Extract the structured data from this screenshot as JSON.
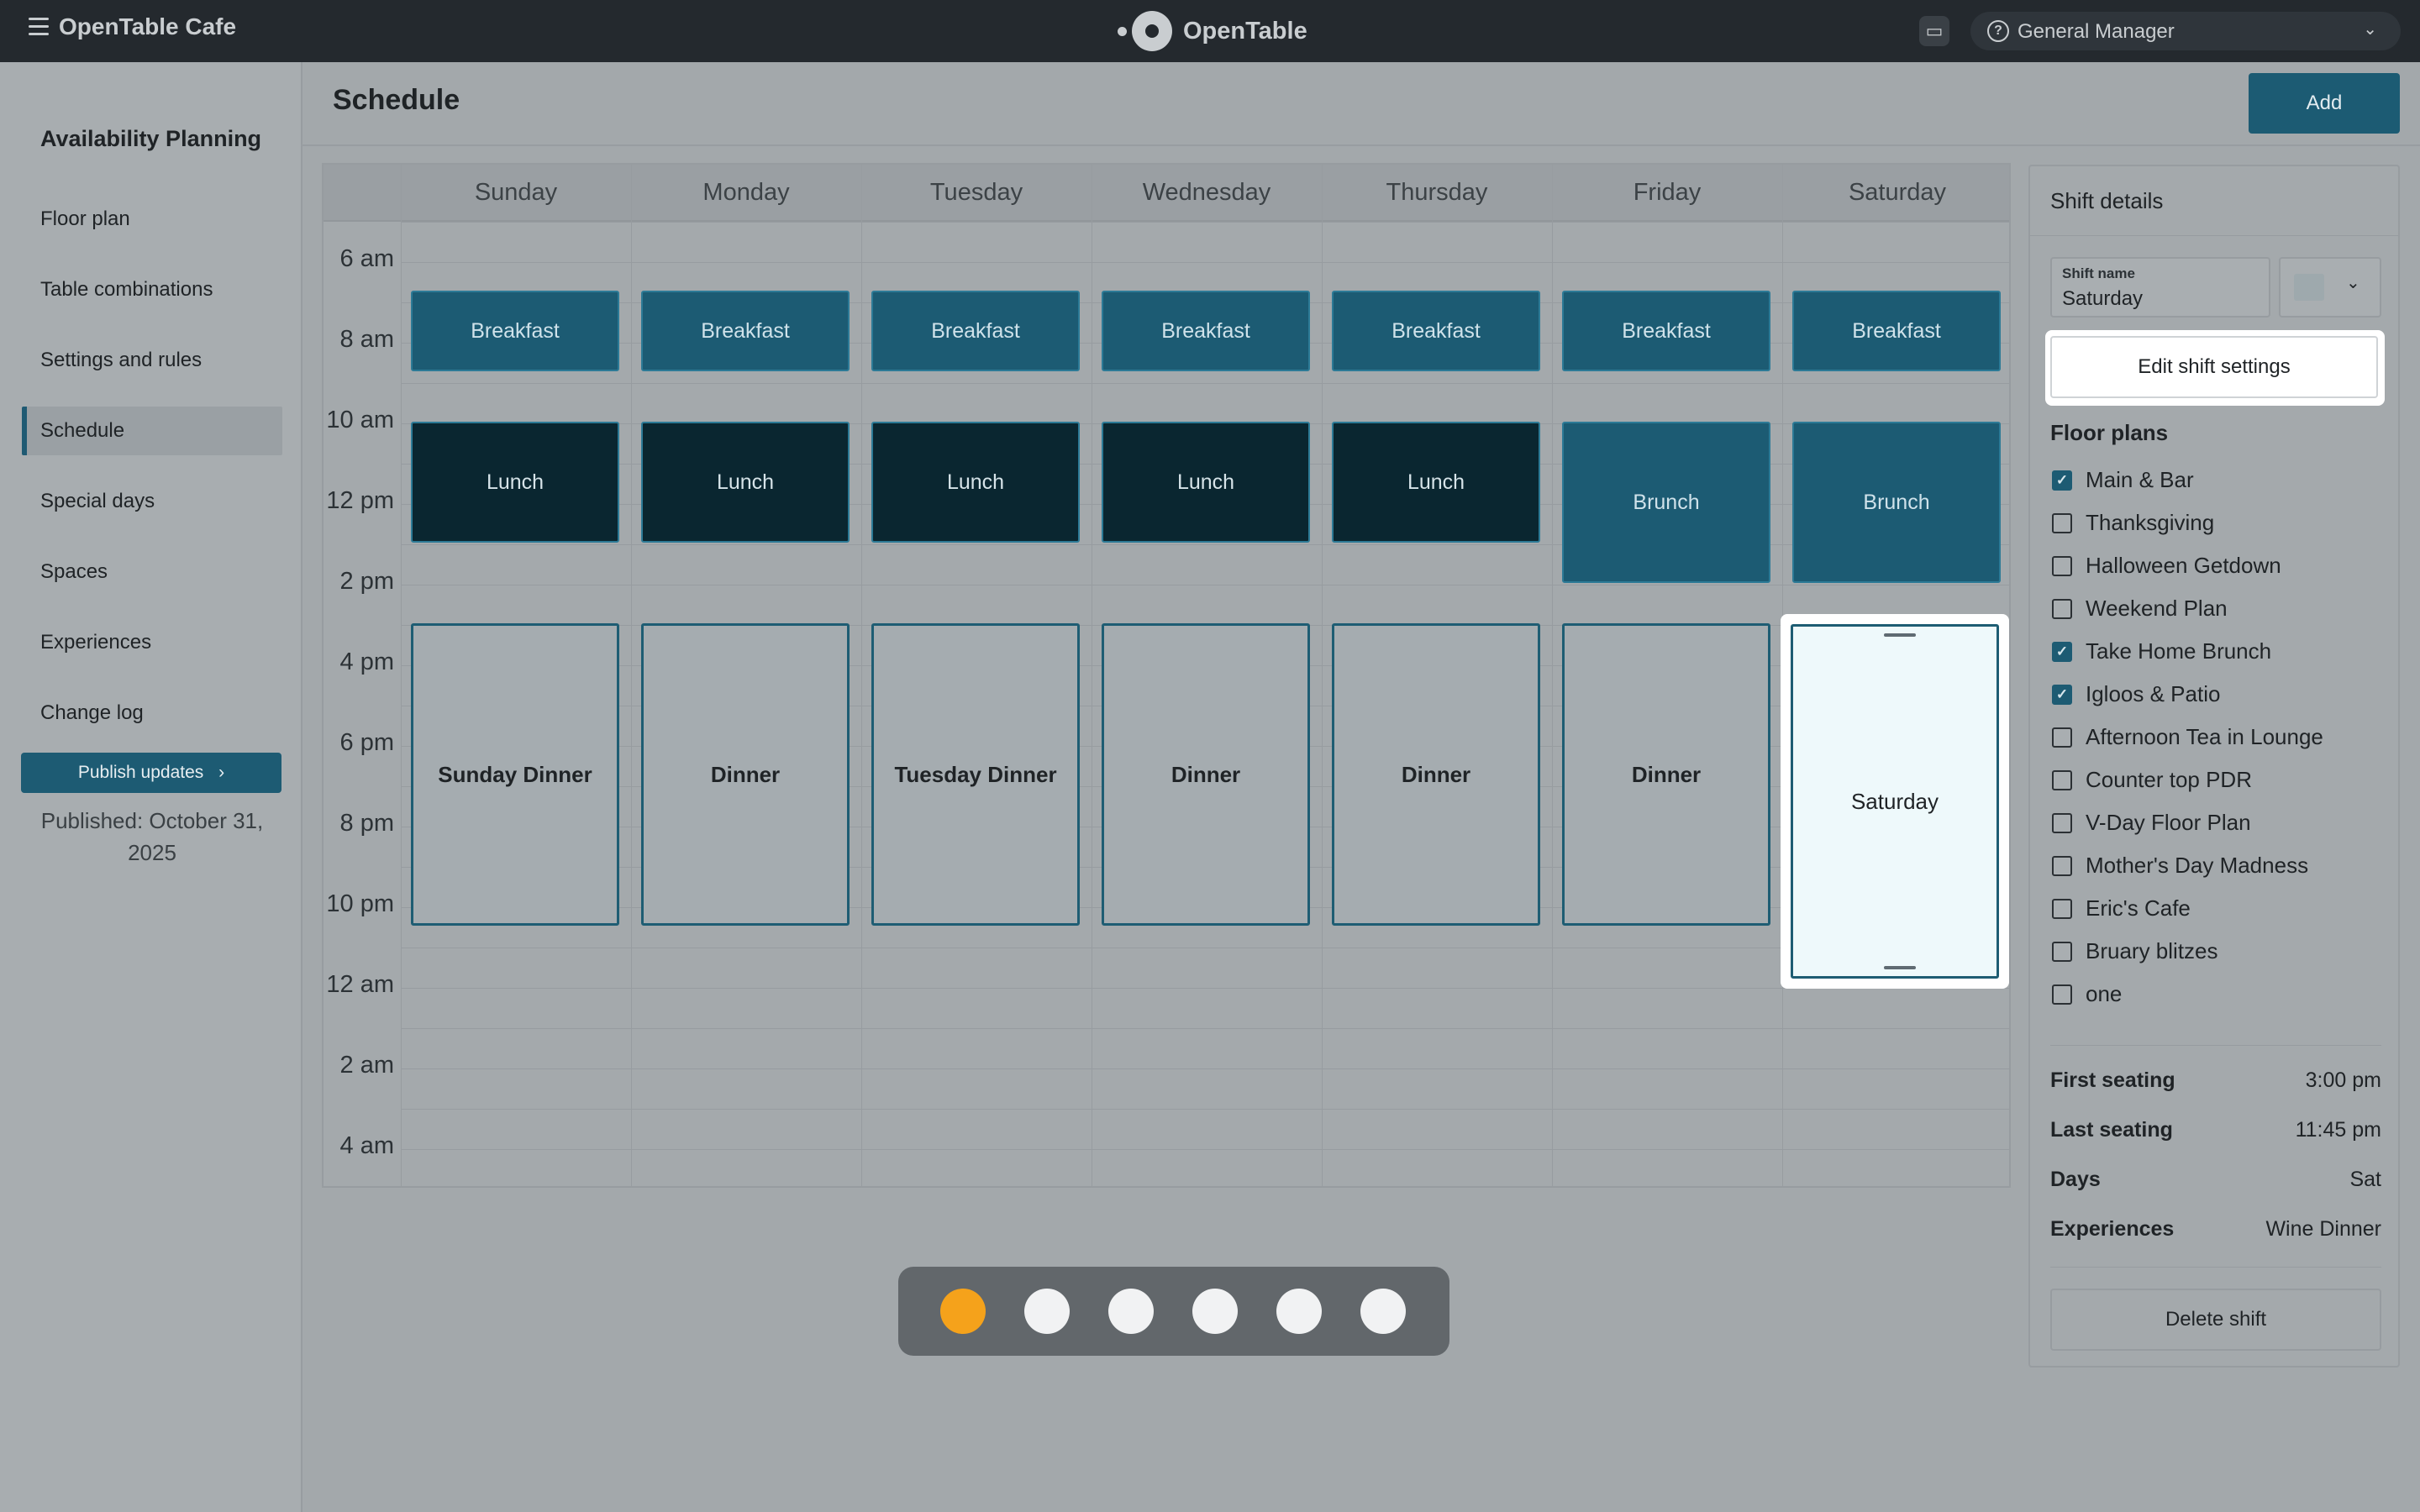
{
  "app": {
    "title": "OpenTable Cafe",
    "logo_text": "OpenTable",
    "role": "General Manager"
  },
  "icons": {
    "menu": "hamburger-icon",
    "chat": "chat-icon",
    "help": "help-circle-icon",
    "chevron": "chevron-down-icon"
  },
  "sidebar": {
    "heading": "Availability Planning",
    "items": [
      {
        "label": "Floor plan"
      },
      {
        "label": "Table combinations"
      },
      {
        "label": "Settings and rules"
      },
      {
        "label": "Schedule",
        "active": true
      },
      {
        "label": "Special days"
      },
      {
        "label": "Spaces"
      },
      {
        "label": "Experiences"
      },
      {
        "label": "Change log"
      }
    ],
    "publish_label": "Publish updates",
    "published_text": "Published: October 31, 2025"
  },
  "page": {
    "title": "Schedule",
    "add_label": "Add"
  },
  "calendar": {
    "days": [
      "Sunday",
      "Monday",
      "Tuesday",
      "Wednesday",
      "Thursday",
      "Friday",
      "Saturday"
    ],
    "times": [
      "6 am",
      "8 am",
      "10 am",
      "12 pm",
      "2 pm",
      "4 pm",
      "6 pm",
      "8 pm",
      "10 pm",
      "12 am",
      "2 am",
      "4 am"
    ],
    "shifts": {
      "breakfast": [
        "Breakfast",
        "Breakfast",
        "Breakfast",
        "Breakfast",
        "Breakfast",
        "Breakfast",
        "Breakfast"
      ],
      "midday": [
        "Lunch",
        "Lunch",
        "Lunch",
        "Lunch",
        "Lunch",
        "Brunch",
        "Brunch"
      ],
      "dinner": [
        "Sunday Dinner",
        "Dinner",
        "Tuesday Dinner",
        "Dinner",
        "Dinner",
        "Dinner",
        "Saturday"
      ]
    }
  },
  "carousel": {
    "count": 6,
    "active_index": 0,
    "active_color": "#f5a21b"
  },
  "shift_details": {
    "title": "Shift details",
    "name_label": "Shift name",
    "name_value": "Saturday",
    "edit_label": "Edit shift settings",
    "floor_plans_heading": "Floor plans",
    "floor_plans": [
      {
        "label": "Main & Bar",
        "checked": true
      },
      {
        "label": "Thanksgiving",
        "checked": false
      },
      {
        "label": "Halloween Getdown",
        "checked": false
      },
      {
        "label": "Weekend Plan",
        "checked": false
      },
      {
        "label": "Take Home Brunch",
        "checked": true
      },
      {
        "label": "Igloos & Patio",
        "checked": true
      },
      {
        "label": "Afternoon Tea in Lounge",
        "checked": false
      },
      {
        "label": "Counter top PDR",
        "checked": false
      },
      {
        "label": "V-Day Floor Plan",
        "checked": false
      },
      {
        "label": "Mother's Day Madness",
        "checked": false
      },
      {
        "label": "Eric's Cafe",
        "checked": false
      },
      {
        "label": "Bruary blitzes",
        "checked": false
      },
      {
        "label": "one",
        "checked": false
      }
    ],
    "first_seating_label": "First seating",
    "first_seating_value": "3:00 pm",
    "last_seating_label": "Last seating",
    "last_seating_value": "11:45 pm",
    "days_label": "Days",
    "days_value": "Sat",
    "experiences_label": "Experiences",
    "experiences_value": "Wine Dinner",
    "delete_label": "Delete shift"
  },
  "colors": {
    "brand": "#1c5b73",
    "lunch": "#0a2630",
    "topbar": "#24292e"
  }
}
